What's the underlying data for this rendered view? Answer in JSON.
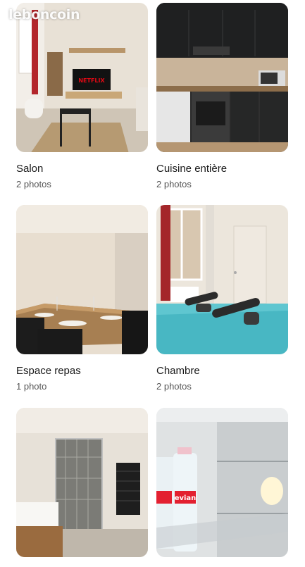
{
  "watermark": "leboncoin",
  "rooms": [
    {
      "title": "Salon",
      "subtitle": "2 photos"
    },
    {
      "title": "Cuisine entière",
      "subtitle": "2 photos"
    },
    {
      "title": "Espace repas",
      "subtitle": "1 photo"
    },
    {
      "title": "Chambre",
      "subtitle": "2 photos"
    },
    {
      "title": "",
      "subtitle": ""
    },
    {
      "title": "",
      "subtitle": ""
    }
  ],
  "tv_brand": "NETFLIX",
  "bottle_brand": "evian"
}
